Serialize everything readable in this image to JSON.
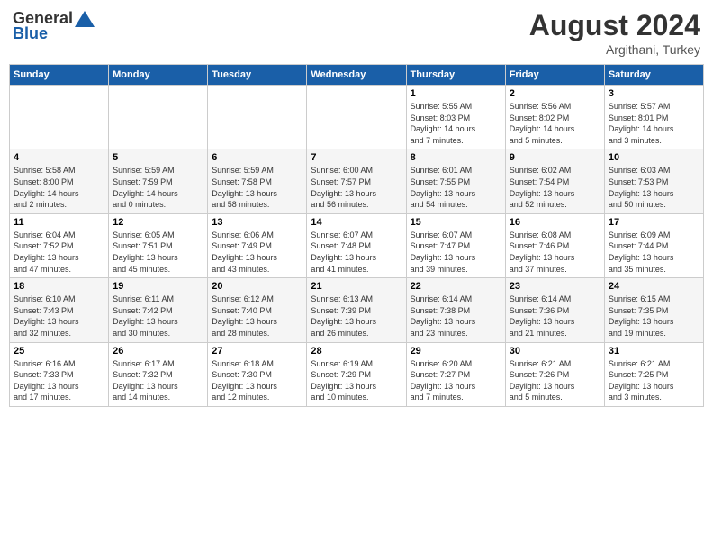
{
  "logo": {
    "general": "General",
    "blue": "Blue"
  },
  "title": "August 2024",
  "location": "Argithani, Turkey",
  "days_of_week": [
    "Sunday",
    "Monday",
    "Tuesday",
    "Wednesday",
    "Thursday",
    "Friday",
    "Saturday"
  ],
  "weeks": [
    [
      {
        "day": "",
        "info": ""
      },
      {
        "day": "",
        "info": ""
      },
      {
        "day": "",
        "info": ""
      },
      {
        "day": "",
        "info": ""
      },
      {
        "day": "1",
        "info": "Sunrise: 5:55 AM\nSunset: 8:03 PM\nDaylight: 14 hours\nand 7 minutes."
      },
      {
        "day": "2",
        "info": "Sunrise: 5:56 AM\nSunset: 8:02 PM\nDaylight: 14 hours\nand 5 minutes."
      },
      {
        "day": "3",
        "info": "Sunrise: 5:57 AM\nSunset: 8:01 PM\nDaylight: 14 hours\nand 3 minutes."
      }
    ],
    [
      {
        "day": "4",
        "info": "Sunrise: 5:58 AM\nSunset: 8:00 PM\nDaylight: 14 hours\nand 2 minutes."
      },
      {
        "day": "5",
        "info": "Sunrise: 5:59 AM\nSunset: 7:59 PM\nDaylight: 14 hours\nand 0 minutes."
      },
      {
        "day": "6",
        "info": "Sunrise: 5:59 AM\nSunset: 7:58 PM\nDaylight: 13 hours\nand 58 minutes."
      },
      {
        "day": "7",
        "info": "Sunrise: 6:00 AM\nSunset: 7:57 PM\nDaylight: 13 hours\nand 56 minutes."
      },
      {
        "day": "8",
        "info": "Sunrise: 6:01 AM\nSunset: 7:55 PM\nDaylight: 13 hours\nand 54 minutes."
      },
      {
        "day": "9",
        "info": "Sunrise: 6:02 AM\nSunset: 7:54 PM\nDaylight: 13 hours\nand 52 minutes."
      },
      {
        "day": "10",
        "info": "Sunrise: 6:03 AM\nSunset: 7:53 PM\nDaylight: 13 hours\nand 50 minutes."
      }
    ],
    [
      {
        "day": "11",
        "info": "Sunrise: 6:04 AM\nSunset: 7:52 PM\nDaylight: 13 hours\nand 47 minutes."
      },
      {
        "day": "12",
        "info": "Sunrise: 6:05 AM\nSunset: 7:51 PM\nDaylight: 13 hours\nand 45 minutes."
      },
      {
        "day": "13",
        "info": "Sunrise: 6:06 AM\nSunset: 7:49 PM\nDaylight: 13 hours\nand 43 minutes."
      },
      {
        "day": "14",
        "info": "Sunrise: 6:07 AM\nSunset: 7:48 PM\nDaylight: 13 hours\nand 41 minutes."
      },
      {
        "day": "15",
        "info": "Sunrise: 6:07 AM\nSunset: 7:47 PM\nDaylight: 13 hours\nand 39 minutes."
      },
      {
        "day": "16",
        "info": "Sunrise: 6:08 AM\nSunset: 7:46 PM\nDaylight: 13 hours\nand 37 minutes."
      },
      {
        "day": "17",
        "info": "Sunrise: 6:09 AM\nSunset: 7:44 PM\nDaylight: 13 hours\nand 35 minutes."
      }
    ],
    [
      {
        "day": "18",
        "info": "Sunrise: 6:10 AM\nSunset: 7:43 PM\nDaylight: 13 hours\nand 32 minutes."
      },
      {
        "day": "19",
        "info": "Sunrise: 6:11 AM\nSunset: 7:42 PM\nDaylight: 13 hours\nand 30 minutes."
      },
      {
        "day": "20",
        "info": "Sunrise: 6:12 AM\nSunset: 7:40 PM\nDaylight: 13 hours\nand 28 minutes."
      },
      {
        "day": "21",
        "info": "Sunrise: 6:13 AM\nSunset: 7:39 PM\nDaylight: 13 hours\nand 26 minutes."
      },
      {
        "day": "22",
        "info": "Sunrise: 6:14 AM\nSunset: 7:38 PM\nDaylight: 13 hours\nand 23 minutes."
      },
      {
        "day": "23",
        "info": "Sunrise: 6:14 AM\nSunset: 7:36 PM\nDaylight: 13 hours\nand 21 minutes."
      },
      {
        "day": "24",
        "info": "Sunrise: 6:15 AM\nSunset: 7:35 PM\nDaylight: 13 hours\nand 19 minutes."
      }
    ],
    [
      {
        "day": "25",
        "info": "Sunrise: 6:16 AM\nSunset: 7:33 PM\nDaylight: 13 hours\nand 17 minutes."
      },
      {
        "day": "26",
        "info": "Sunrise: 6:17 AM\nSunset: 7:32 PM\nDaylight: 13 hours\nand 14 minutes."
      },
      {
        "day": "27",
        "info": "Sunrise: 6:18 AM\nSunset: 7:30 PM\nDaylight: 13 hours\nand 12 minutes."
      },
      {
        "day": "28",
        "info": "Sunrise: 6:19 AM\nSunset: 7:29 PM\nDaylight: 13 hours\nand 10 minutes."
      },
      {
        "day": "29",
        "info": "Sunrise: 6:20 AM\nSunset: 7:27 PM\nDaylight: 13 hours\nand 7 minutes."
      },
      {
        "day": "30",
        "info": "Sunrise: 6:21 AM\nSunset: 7:26 PM\nDaylight: 13 hours\nand 5 minutes."
      },
      {
        "day": "31",
        "info": "Sunrise: 6:21 AM\nSunset: 7:25 PM\nDaylight: 13 hours\nand 3 minutes."
      }
    ]
  ]
}
